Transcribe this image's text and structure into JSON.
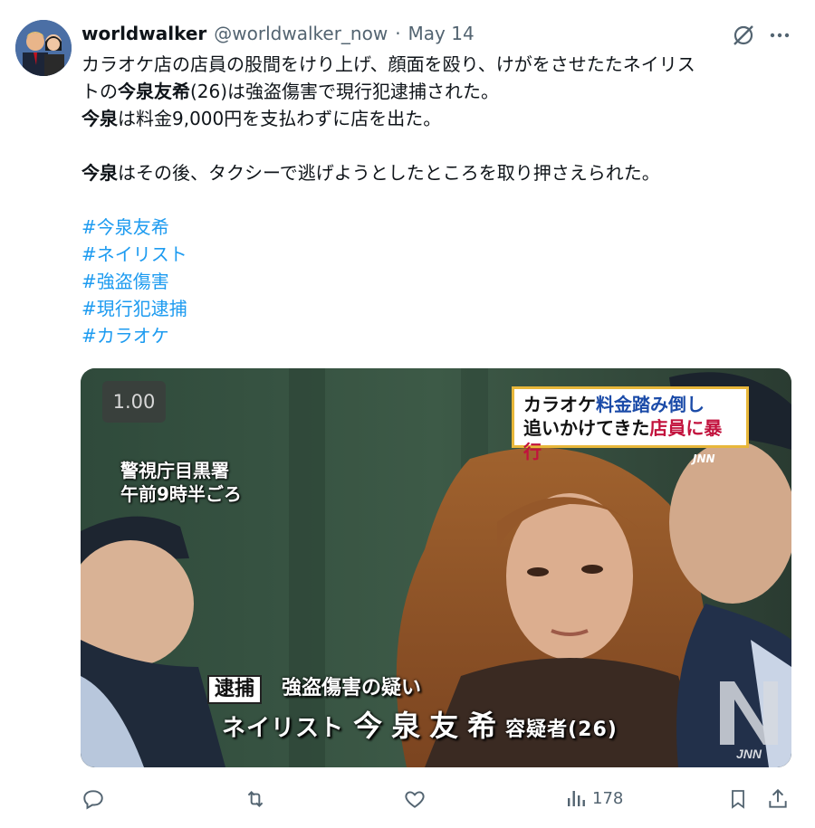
{
  "tweet": {
    "display_name": "worldwalker",
    "handle": "@worldwalker_now",
    "separator": "·",
    "date": "May 14",
    "line1": "カラオケ店の店員の股間をけり上げ、顔面を殴り、けがをさせたたネイリス",
    "line2_pre": "トの",
    "line2_bold": "今泉友希",
    "line2_post": "(26)は強盗傷害で現行犯逮捕された。",
    "line3_bold": "今泉",
    "line3_post": "は料金9,000円を支払わずに店を出た。",
    "line4_bold": "今泉",
    "line4_post": "はその後、タクシーで逃げようとしたところを取り押さえられた。",
    "hashtags": [
      "#今泉友希",
      "#ネイリスト",
      "#強盗傷害",
      "#現行犯逮捕",
      "#カラオケ"
    ]
  },
  "media": {
    "playback_speed": "1.00",
    "caption_line1_a": "カラオケ",
    "caption_line1_b": "料金踏み倒し",
    "caption_line2_a": "追いかけてきた",
    "caption_line2_b": "店員に暴行",
    "location_line1": "警視庁目黒署",
    "location_line2": "午前9時半ごろ",
    "small_logo": "JNN",
    "arrest_tag": "逮捕",
    "charge": "強盗傷害の疑い",
    "occupation": "ネイリスト",
    "suspect_name": "今泉友希",
    "suspect_suffix": "容疑者(26)",
    "logo_text": "JNN"
  },
  "actions": {
    "views": "178"
  },
  "colors": {
    "link": "#1d9bf0",
    "muted": "#536471",
    "caption_red": "#c2123d",
    "caption_blue": "#1b4ba8"
  }
}
